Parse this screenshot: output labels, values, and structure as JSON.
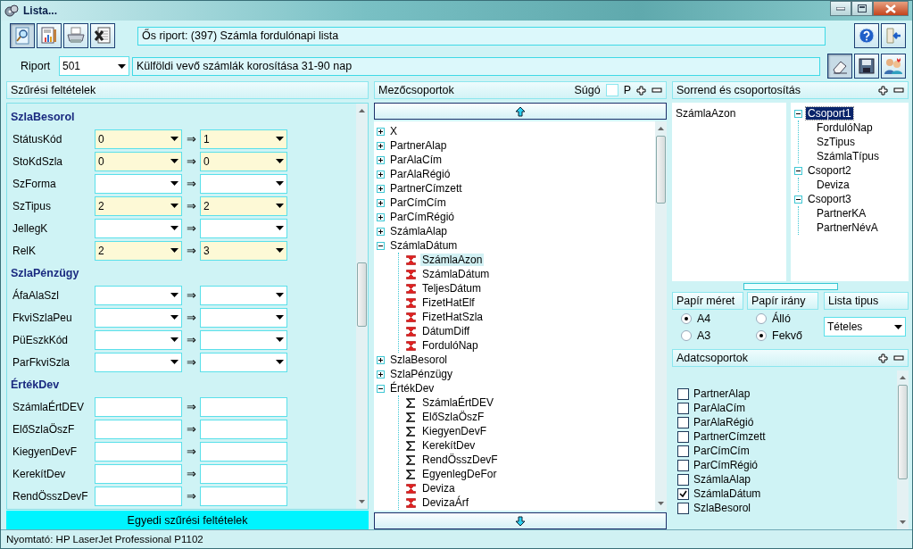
{
  "window": {
    "title": "Lista..."
  },
  "toolbar": {
    "parent_report": "Ős riport: (397)  Számla fordulónapi lista"
  },
  "report": {
    "label": "Riport",
    "number": "501",
    "description": "Külföldi vevő számlák korosítása 31-90 nap"
  },
  "filter_panel": {
    "title": "Szűrési feltételek",
    "custom_button": "Egyedi szűrési feltételek",
    "sections": [
      {
        "title": "SzlaBesorol",
        "rows": [
          {
            "label": "StátusKód",
            "kind": "combo",
            "from": "0",
            "arrow": "⇒",
            "to": "1"
          },
          {
            "label": "StoKdSzla",
            "kind": "combo",
            "from": "0",
            "arrow": "⇒",
            "to": "0"
          },
          {
            "label": "SzForma",
            "kind": "combo",
            "arrow": "⇒"
          },
          {
            "label": "SzTipus",
            "kind": "combo",
            "from": "2",
            "arrow": "⇒",
            "to": "2"
          },
          {
            "label": "JellegK",
            "kind": "combo",
            "arrow": "⇒"
          },
          {
            "label": "RelK",
            "kind": "combo",
            "from": "2",
            "arrow": "⇒",
            "to": "3"
          }
        ]
      },
      {
        "title": "SzlaPénzügy",
        "rows": [
          {
            "label": "ÁfaAlaSzl",
            "kind": "combo",
            "arrow": "⇒"
          },
          {
            "label": "FkviSzlaPeu",
            "kind": "combo",
            "arrow": "⇒"
          },
          {
            "label": "PüEszkKód",
            "kind": "combo",
            "arrow": "⇒"
          },
          {
            "label": "ParFkviSzla",
            "kind": "combo",
            "arrow": "⇒"
          }
        ]
      },
      {
        "title": "ÉrtékDev",
        "rows": [
          {
            "label": "SzámlaÉrtDEV",
            "kind": "text",
            "arrow": "⇒"
          },
          {
            "label": "ElőSzlaÖszF",
            "kind": "text",
            "arrow": "⇒"
          },
          {
            "label": "KiegyenDevF",
            "kind": "text",
            "arrow": "⇒"
          },
          {
            "label": "KerekítDev",
            "kind": "text",
            "arrow": "⇒"
          },
          {
            "label": "RendÖsszDevF",
            "kind": "text",
            "arrow": "⇒"
          }
        ]
      }
    ]
  },
  "field_groups": {
    "title": "Mezőcsoportok",
    "help_label": "Súgó",
    "help_checked": false,
    "p_label": "P",
    "tree": [
      {
        "label": "X",
        "expanded": false,
        "selected": false
      },
      {
        "label": "PartnerAlap",
        "expanded": false,
        "selected": false
      },
      {
        "label": "ParAlaCím",
        "expanded": false,
        "selected": false
      },
      {
        "label": "ParAlaRégió",
        "expanded": false,
        "selected": false
      },
      {
        "label": "PartnerCímzett",
        "expanded": false,
        "selected": false
      },
      {
        "label": "ParCímCím",
        "expanded": false,
        "selected": false
      },
      {
        "label": "ParCímRégió",
        "expanded": false,
        "selected": false
      },
      {
        "label": "SzámlaAlap",
        "expanded": false,
        "selected": false
      },
      {
        "label": "SzámlaDátum",
        "expanded": true,
        "selected": false,
        "children": [
          {
            "label": "SzámlaAzon",
            "kind": "hourglass",
            "selected": true
          },
          {
            "label": "SzámlaDátum",
            "kind": "hourglass",
            "selected": false
          },
          {
            "label": "TeljesDátum",
            "kind": "hourglass",
            "selected": false
          },
          {
            "label": "FizetHatElf",
            "kind": "hourglass",
            "selected": false
          },
          {
            "label": "FizetHatSzla",
            "kind": "hourglass",
            "selected": false
          },
          {
            "label": "DátumDiff",
            "kind": "hourglass",
            "selected": false
          },
          {
            "label": "FordulóNap",
            "kind": "hourglass",
            "selected": false
          }
        ]
      },
      {
        "label": "SzlaBesorol",
        "expanded": false,
        "selected": false
      },
      {
        "label": "SzlaPénzügy",
        "expanded": false,
        "selected": false
      },
      {
        "label": "ÉrtékDev",
        "expanded": true,
        "selected": false,
        "children": [
          {
            "label": "SzámlaÉrtDEV",
            "kind": "sigma",
            "selected": false
          },
          {
            "label": "ElőSzlaÖszF",
            "kind": "sigma",
            "selected": false
          },
          {
            "label": "KiegyenDevF",
            "kind": "sigma",
            "selected": false
          },
          {
            "label": "KerekítDev",
            "kind": "sigma",
            "selected": false
          },
          {
            "label": "RendÖsszDevF",
            "kind": "sigma",
            "selected": false
          },
          {
            "label": "EgyenlegDeFor",
            "kind": "sigma",
            "selected": false
          },
          {
            "label": "Deviza",
            "kind": "hourglass",
            "selected": false
          },
          {
            "label": "DevizaÁrf",
            "kind": "hourglass",
            "selected": false
          }
        ]
      }
    ]
  },
  "sort_panel": {
    "title": "Sorrend és csoportosítás",
    "sort_fields": [
      "SzámlaAzon"
    ],
    "groups": [
      {
        "label": "Csoport1",
        "expanded": true,
        "selected": true,
        "children": [
          {
            "label": "FordulóNap",
            "selected": false
          },
          {
            "label": "SzTipus",
            "selected": false
          },
          {
            "label": "SzámlaTípus",
            "selected": false
          }
        ]
      },
      {
        "label": "Csoport2",
        "expanded": true,
        "selected": false,
        "children": [
          {
            "label": "Deviza",
            "selected": false
          }
        ]
      },
      {
        "label": "Csoport3",
        "expanded": true,
        "selected": false,
        "children": [
          {
            "label": "PartnerKA",
            "selected": false
          },
          {
            "label": "PartnerNévA",
            "selected": false
          }
        ]
      }
    ]
  },
  "paper_size": {
    "label": "Papír méret",
    "options": [
      {
        "label": "A4",
        "selected": true
      },
      {
        "label": "A3",
        "selected": false
      }
    ]
  },
  "orientation": {
    "label": "Papír irány",
    "options": [
      {
        "label": "Álló",
        "selected": false
      },
      {
        "label": "Fekvő",
        "selected": true
      }
    ]
  },
  "list_type": {
    "label": "Lista tipus",
    "value": "Tételes"
  },
  "data_groups": {
    "title": "Adatcsoportok",
    "items": [
      {
        "label": "PartnerAlap",
        "checked": false
      },
      {
        "label": "ParAlaCím",
        "checked": false
      },
      {
        "label": "ParAlaRégió",
        "checked": false
      },
      {
        "label": "PartnerCímzett",
        "checked": false
      },
      {
        "label": "ParCímCím",
        "checked": false
      },
      {
        "label": "ParCímRégió",
        "checked": false
      },
      {
        "label": "SzámlaAlap",
        "checked": false
      },
      {
        "label": "SzámlaDátum",
        "checked": true
      },
      {
        "label": "SzlaBesorol",
        "checked": false
      }
    ]
  },
  "status_bar": "Nyomtató: HP LaserJet Professional P1102"
}
